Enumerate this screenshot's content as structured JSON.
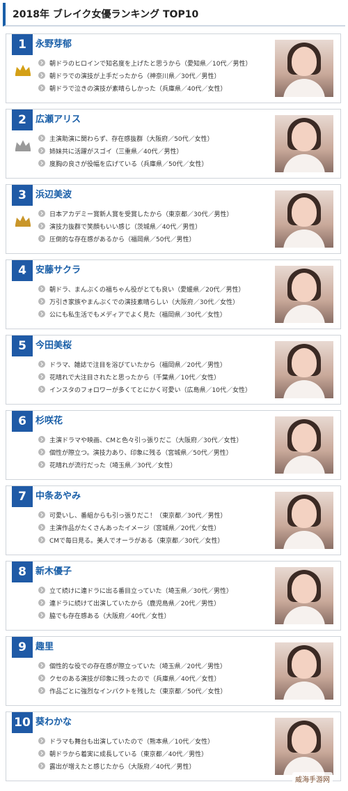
{
  "header": {
    "title": "2018年 ブレイク女優ランキング TOP10"
  },
  "ranking": [
    {
      "rank": "1",
      "name": "永野芽郁",
      "crown": "gold",
      "reasons": [
        "朝ドラのヒロインで知名度を上げたと思うから（愛知県／10代／男性）",
        "朝ドラでの演技が上手だったから（神奈川県／30代／男性）",
        "朝ドラで泣きの演技が素晴らしかった（兵庫県／40代／女性）"
      ]
    },
    {
      "rank": "2",
      "name": "広瀬アリス",
      "crown": "silver",
      "reasons": [
        "主演助演に関わらず、存在感抜群（大阪府／50代／女性）",
        "姉妹共に活躍がスゴイ（三重県／40代／男性）",
        "度胸の良さが役幅を広げている（兵庫県／50代／女性）"
      ]
    },
    {
      "rank": "3",
      "name": "浜辺美波",
      "crown": "bronze",
      "reasons": [
        "日本アカデミー賞新人賞を受賞したから（東京都／30代／男性）",
        "演技力抜群で笑顔もいい感じ（茨城県／40代／男性）",
        "圧倒的な存在感があるから（福岡県／50代／男性）"
      ]
    },
    {
      "rank": "4",
      "name": "安藤サクラ",
      "crown": "",
      "reasons": [
        "朝ドラ、まんぷくの福ちゃん役がとても良い（愛媛県／20代／男性）",
        "万引き家族やまんぷくでの演技素晴らしい（大阪府／30代／女性）",
        "公にも私生活でもメディアでよく見た（福岡県／30代／女性）"
      ]
    },
    {
      "rank": "5",
      "name": "今田美桜",
      "crown": "",
      "reasons": [
        "ドラマ、雑誌で注目を浴びていたから（福岡県／20代／男性）",
        "花晴れで大注目されたと思ったから（千葉県／10代／女性）",
        "インスタのフォロワーが多くてとにかく可愛い（広島県／10代／女性）"
      ]
    },
    {
      "rank": "6",
      "name": "杉咲花",
      "crown": "",
      "reasons": [
        "主演ドラマや映画、CMと色々引っ張りだこ（大阪府／30代／女性）",
        "個性が際立つ。演技力あり、印象に残る（宮城県／50代／男性）",
        "花晴れが流行だった（埼玉県／30代／女性）"
      ]
    },
    {
      "rank": "7",
      "name": "中条あやみ",
      "crown": "",
      "reasons": [
        "可愛いし、番組からも引っ張りだこ！（東京都／30代／男性）",
        "主演作品がたくさんあったイメージ（宮城県／20代／女性）",
        "CMで毎日見る。美人でオーラがある（東京都／30代／女性）"
      ]
    },
    {
      "rank": "8",
      "name": "新木優子",
      "crown": "",
      "reasons": [
        "立て続けに連ドラに出る番目立っていた（埼玉県／30代／男性）",
        "連ドラに続けて出演していたから（鹿児島県／20代／男性）",
        "脇でも存在感ある（大阪府／40代／女性）"
      ]
    },
    {
      "rank": "9",
      "name": "趣里",
      "crown": "",
      "reasons": [
        "個性的な役での存在感が際立っていた（埼玉県／20代／男性）",
        "クセのある演技が印象に残ったので（兵庫県／40代／女性）",
        "作品ごとに強烈なインパクトを残した（東京都／50代／女性）"
      ]
    },
    {
      "rank": "10",
      "name": "葵わかな",
      "crown": "",
      "reasons": [
        "ドラマも舞台も出演していたので（熊本県／10代／女性）",
        "朝ドラから着実に成長している（東京都／40代／男性）",
        "露出が増えたと感じたから（大阪府／40代／男性）"
      ]
    }
  ],
  "watermark": {
    "text": "威海手游网"
  },
  "colors": {
    "badge": "#1f5aa6",
    "name": "#1a5fa8",
    "crown_gold": "#d4a017",
    "crown_silver": "#9a9a9a",
    "crown_bronze": "#c9962a"
  }
}
